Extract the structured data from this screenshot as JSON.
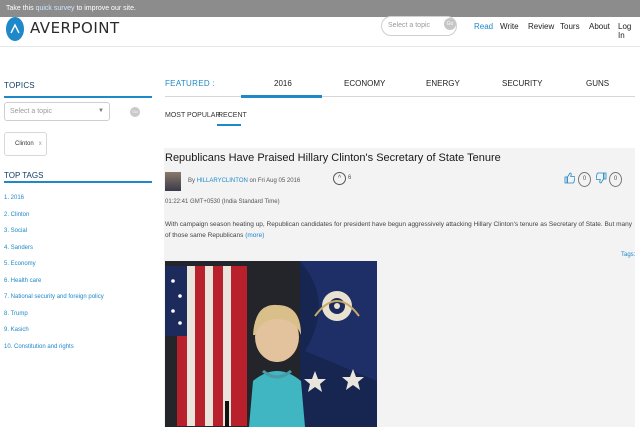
{
  "survey": {
    "prefix": "Take this",
    "link": "quick survey",
    "suffix": "to improve our site."
  },
  "header": {
    "logo_text": "AVERPOINT",
    "search_placeholder": "Select a topic",
    "search_go": "Go",
    "nav": [
      "Read",
      "Write",
      "Review",
      "Tours",
      "About",
      "Log In"
    ],
    "active_nav": "Read"
  },
  "sidebar": {
    "topics_heading": "TOPICS",
    "topic_select_placeholder": "Select a topic",
    "go_label": "Go",
    "chip": {
      "label": "Clinton",
      "remove": "x"
    },
    "top_tags_heading": "TOP TAGS",
    "tags": [
      "1. 2016",
      "2. Clinton",
      "3. Social",
      "4. Sanders",
      "5. Economy",
      "6. Health care",
      "7. National security and foreign policy",
      "8. Trump",
      "9. Kasich",
      "10. Constitution and rights"
    ]
  },
  "main": {
    "featured_label": "FEATURED :",
    "tabs": [
      "2016",
      "ECONOMY",
      "ENERGY",
      "SECURITY",
      "GUNS"
    ],
    "active_tab": "2016",
    "subtabs": [
      "MOST POPULAR",
      "RECENT"
    ],
    "active_subtab": "RECENT"
  },
  "article": {
    "title": "Republicans Have Praised Hillary Clinton's Secretary of State Tenure",
    "by": "By",
    "author": "HILLARYCLINTON",
    "date": "on Fri Aug 05 2016",
    "vote_count": "6",
    "likes": "0",
    "dislikes": "0",
    "timestamp": "01:22:41 GMT+0530 (India Standard Time)",
    "snippet": "With campaign season heating up, Republican candidates for president have begun aggressively attacking Hillary Clinton's tenure as Secretary of State. But many of those same Republicans",
    "more": "(more)",
    "tags_label": "Tags:"
  },
  "colors": {
    "accent": "#1e88c8",
    "survey_bar": "#8c8c8c",
    "article_bg": "#f3f3f3"
  }
}
